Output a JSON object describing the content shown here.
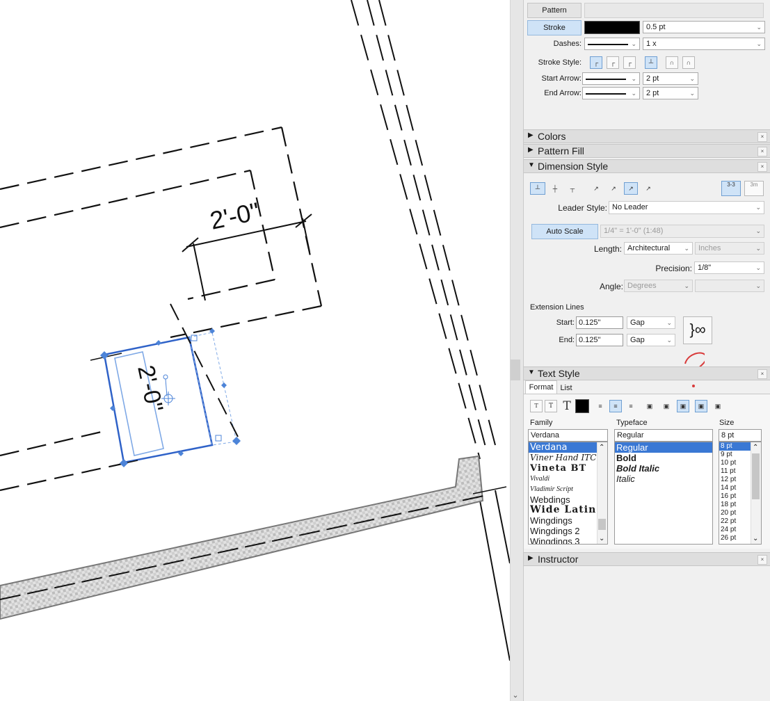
{
  "stroke_panel": {
    "pattern_label": "Pattern",
    "stroke_label": "Stroke",
    "stroke_color": "#000000",
    "stroke_weight": "0.5 pt",
    "dashes_label": "Dashes:",
    "dash_scale": "1 x",
    "stroke_style_label": "Stroke Style:",
    "start_arrow_label": "Start Arrow:",
    "start_arrow_size": "2 pt",
    "end_arrow_label": "End Arrow:",
    "end_arrow_size": "2 pt"
  },
  "sections": {
    "colors": "Colors",
    "pattern_fill": "Pattern Fill",
    "dimension_style": "Dimension Style",
    "text_style": "Text Style",
    "instructor": "Instructor"
  },
  "dimension_style": {
    "leader_style_label": "Leader Style:",
    "leader_style_value": "No Leader",
    "auto_scale_label": "Auto Scale",
    "scale_value": "1/4\" = 1'-0\" (1:48)",
    "length_label": "Length:",
    "length_value": "Architectural",
    "length_unit": "Inches",
    "precision_label": "Precision:",
    "precision_value": "1/8\"",
    "angle_label": "Angle:",
    "angle_value": "Degrees",
    "extension_lines_label": "Extension Lines",
    "start_label": "Start:",
    "start_value": "0.125\"",
    "start_mode": "Gap",
    "end_label": "End:",
    "end_value": "0.125\"",
    "end_mode": "Gap",
    "icon_33": "3-3",
    "icon_3m": "3m"
  },
  "text_style": {
    "tab_format": "Format",
    "tab_list": "List",
    "family_label": "Family",
    "typeface_label": "Typeface",
    "size_label": "Size",
    "family_value": "Verdana",
    "typeface_value": "Regular",
    "size_value": "8 pt",
    "families": [
      "Verdana",
      "Viner Hand ITC",
      "Vineta BT",
      "Vivaldi",
      "Vladimir Script",
      "Webdings",
      "Wide Latin",
      "Wingdings",
      "Wingdings 2",
      "Wingdings 3"
    ],
    "typefaces": [
      "Regular",
      "Bold",
      "Bold Italic",
      "Italic"
    ],
    "sizes": [
      "8 pt",
      "9 pt",
      "10 pt",
      "11 pt",
      "12 pt",
      "14 pt",
      "16 pt",
      "18 pt",
      "20 pt",
      "22 pt",
      "24 pt",
      "26 pt"
    ]
  },
  "annotation": {
    "question_mark": "?"
  },
  "drawing": {
    "dimension_top": "2'-0\"",
    "dimension_selected": "2'-0\""
  },
  "colors": {
    "selection_blue": "#2f62c8",
    "annotation_red": "#d83a3a",
    "accent_button": "#cfe3f7"
  }
}
